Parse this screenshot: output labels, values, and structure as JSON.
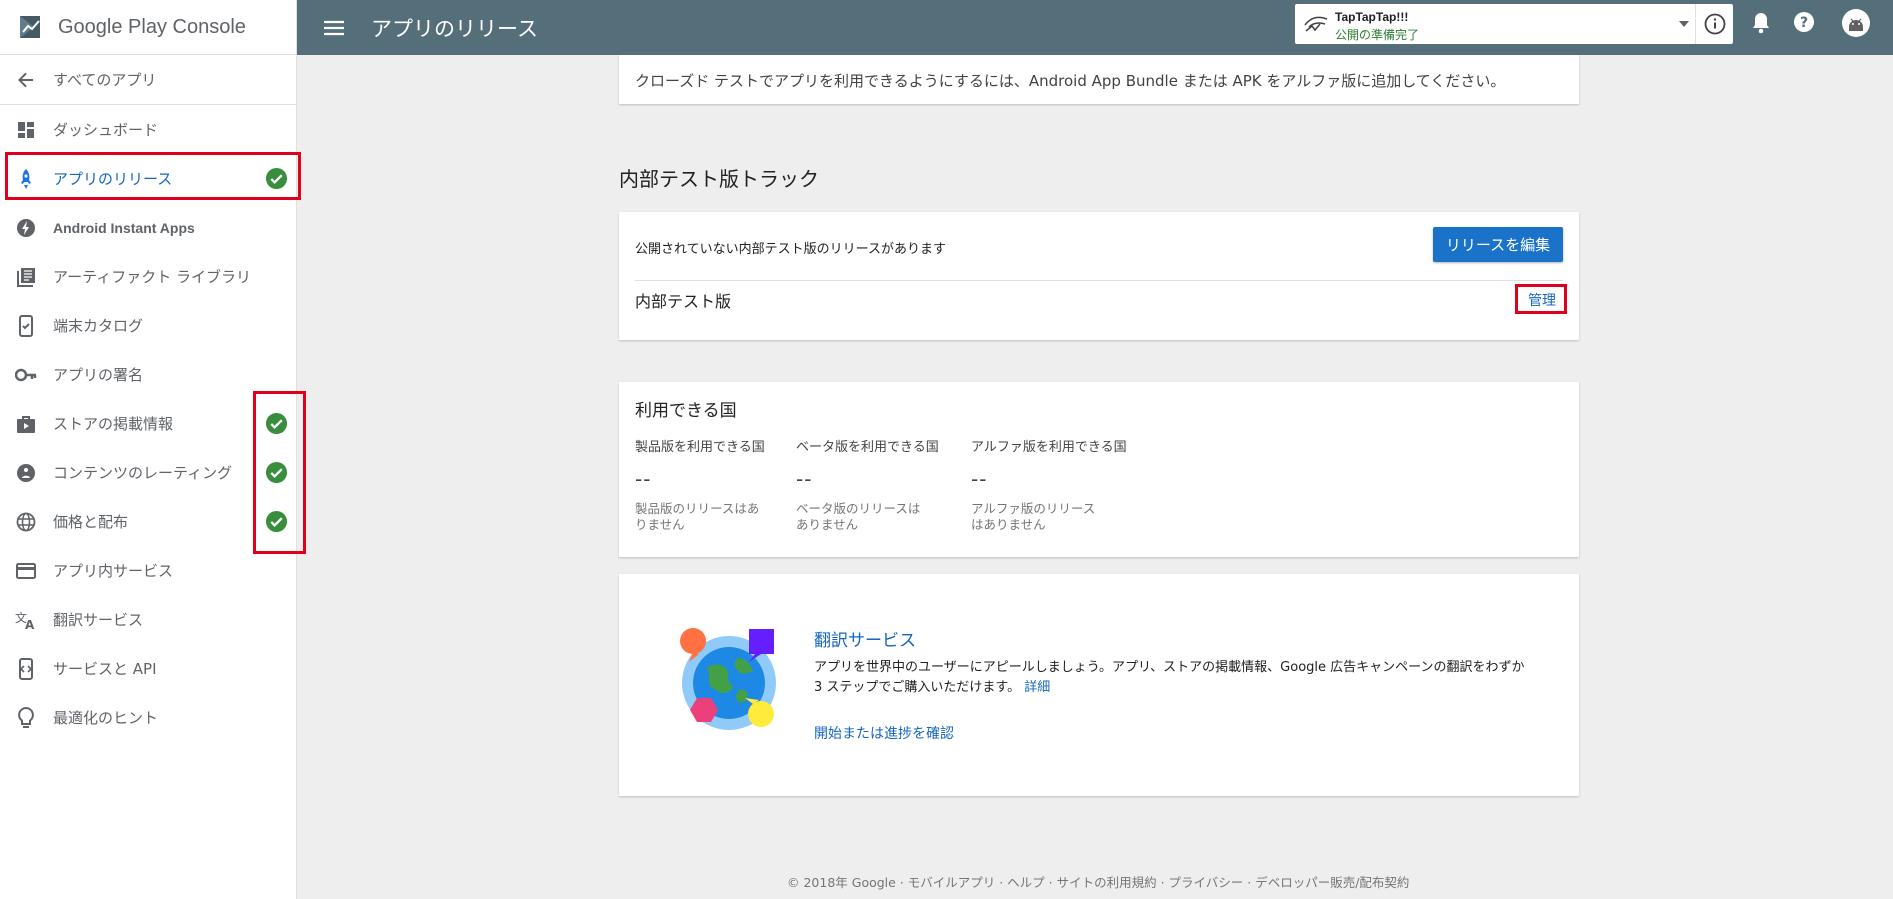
{
  "sidebar": {
    "logo_text": "Google Play Console",
    "back_label": "すべてのアプリ",
    "items": [
      {
        "label": "ダッシュボード",
        "icon": "dashboard-icon",
        "status": ""
      },
      {
        "label": "アプリのリリース",
        "icon": "rocket-icon",
        "status": "complete",
        "active": true
      },
      {
        "label": "Android Instant Apps",
        "icon": "bolt-icon",
        "status": ""
      },
      {
        "label": "アーティファクト ライブラリ",
        "icon": "library-icon",
        "status": ""
      },
      {
        "label": "端末カタログ",
        "icon": "device-icon",
        "status": ""
      },
      {
        "label": "アプリの署名",
        "icon": "key-icon",
        "status": ""
      },
      {
        "label": "ストアの掲載情報",
        "icon": "store-icon",
        "status": "complete"
      },
      {
        "label": "コンテンツのレーティング",
        "icon": "rating-icon",
        "status": "complete"
      },
      {
        "label": "価格と配布",
        "icon": "globe-icon",
        "status": "complete"
      },
      {
        "label": "アプリ内サービス",
        "icon": "card-icon",
        "status": ""
      },
      {
        "label": "翻訳サービス",
        "icon": "translate-icon",
        "status": ""
      },
      {
        "label": "サービスと API",
        "icon": "api-icon",
        "status": ""
      },
      {
        "label": "最適化のヒント",
        "icon": "bulb-icon",
        "status": ""
      }
    ]
  },
  "topbar": {
    "title": "アプリのリリース",
    "app_name": "TapTapTap!!!",
    "app_status": "公開の準備完了"
  },
  "main": {
    "notice": "クローズド テストでアプリを利用できるようにするには、Android App Bundle または APK をアルファ版に追加してください。",
    "section_title": "内部テスト版トラック",
    "internal": {
      "message": "公開されていない内部テスト版のリリースがあります",
      "edit_button": "リリースを編集",
      "track_name": "内部テスト版",
      "manage_link": "管理"
    },
    "countries": {
      "title": "利用できる国",
      "columns": [
        {
          "head": "製品版を利用できる国",
          "value": "--",
          "note_line1": "製品版のリリースはあ",
          "note_line2": "りません"
        },
        {
          "head": "ベータ版を利用できる国",
          "value": "--",
          "note_line1": "ベータ版のリリースは",
          "note_line2": "ありません"
        },
        {
          "head": "アルファ版を利用できる国",
          "value": "--",
          "note_line1": "アルファ版のリリース",
          "note_line2": "はありません"
        }
      ]
    },
    "translate": {
      "title": "翻訳サービス",
      "desc_line1": "アプリを世界中のユーザーにアピールしましょう。アプリ、ストアの掲載情報、Google 広告キャンペーンの翻訳をわずか",
      "desc_line2": "3 ステップでご購入いただけます。",
      "more_link": "詳細",
      "action": "開始または進捗を確認"
    }
  },
  "footer": "© 2018年 Google · モバイルアプリ · ヘルプ · サイトの利用規約 · プライバシー · デベロッパー販売/配布契約",
  "colors": {
    "topbar": "#546e7a",
    "accent": "#1a73c8",
    "check": "#388e3c",
    "highlight": "#e0001b"
  }
}
